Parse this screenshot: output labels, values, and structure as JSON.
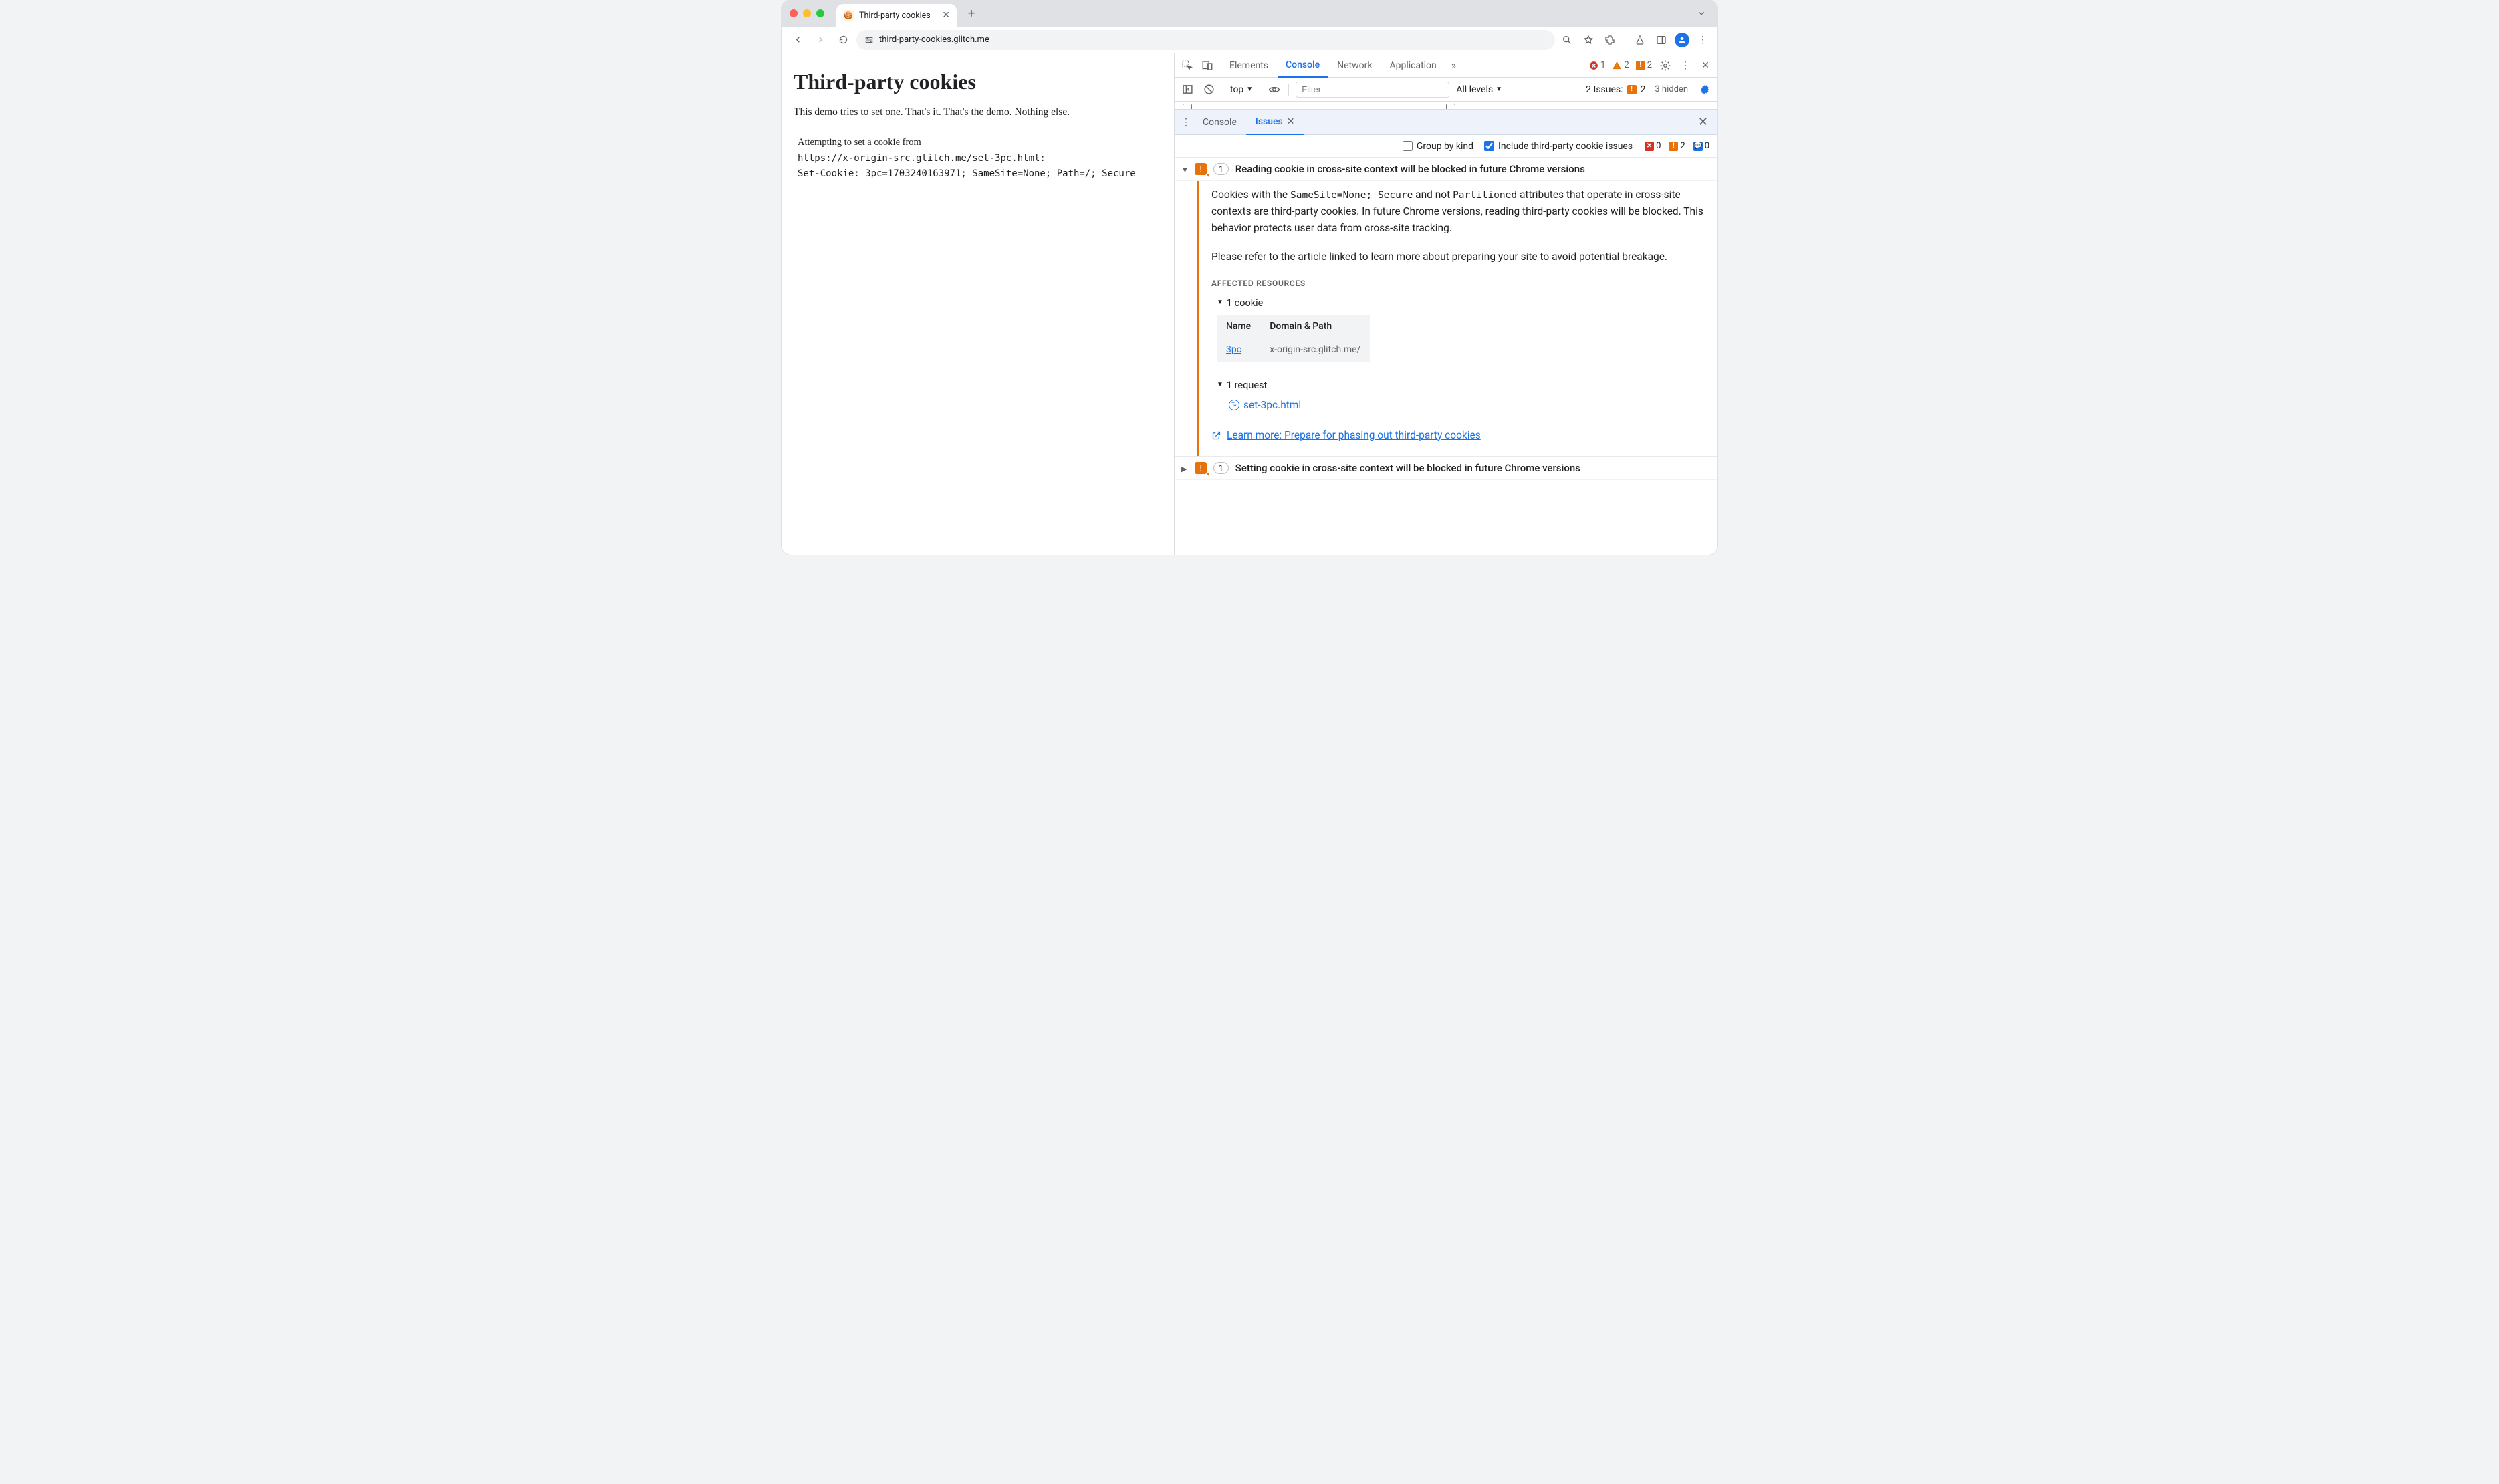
{
  "browser_tab": {
    "title": "Third-party cookies"
  },
  "omnibox": {
    "url": "third-party-cookies.glitch.me"
  },
  "page": {
    "heading": "Third-party cookies",
    "intro": "This demo tries to set one. That's it. That's the demo. Nothing else.",
    "attempt_label": "Attempting to set a cookie from",
    "attempt_url": "https://x-origin-src.glitch.me/set-3pc.html:",
    "set_cookie": "Set-Cookie: 3pc=1703240163971; SameSite=None; Path=/; Secure"
  },
  "devtools": {
    "tabs": {
      "elements": "Elements",
      "console": "Console",
      "network": "Network",
      "application": "Application"
    },
    "counters": {
      "errors": "1",
      "warnings": "2",
      "breaking": "2"
    },
    "subbar": {
      "context": "top",
      "filter_placeholder": "Filter",
      "levels": "All levels",
      "issues_label": "2 Issues:",
      "issues_breaking": "2",
      "hidden": "3 hidden"
    },
    "drawer": {
      "console": "Console",
      "issues": "Issues"
    },
    "issues_toolbar": {
      "group_label": "Group by kind",
      "include_label": "Include third-party cookie issues",
      "counts": {
        "red": "0",
        "orange": "2",
        "blue": "0"
      }
    },
    "issue1": {
      "count": "1",
      "title": "Reading cookie in cross-site context will be blocked in future Chrome versions",
      "para1a": "Cookies with the ",
      "para1b": "SameSite=None; Secure",
      "para1c": " and not ",
      "para1d": "Partitioned",
      "para1e": " attributes that operate in cross-site contexts are third-party cookies. In future Chrome versions, reading third-party cookies will be blocked. This behavior protects user data from cross-site tracking.",
      "para2": "Please refer to the article linked to learn more about preparing your site to avoid potential breakage.",
      "affected_heading": "AFFECTED RESOURCES",
      "cookie_toggle": "1 cookie",
      "table_head_name": "Name",
      "table_head_domain": "Domain & Path",
      "table_name": "3pc",
      "table_domain": "x-origin-src.glitch.me/",
      "request_toggle": "1 request",
      "request_name": "set-3pc.html",
      "learn_more": "Learn more: Prepare for phasing out third-party cookies"
    },
    "issue2": {
      "count": "1",
      "title": "Setting cookie in cross-site context will be blocked in future Chrome versions"
    }
  }
}
